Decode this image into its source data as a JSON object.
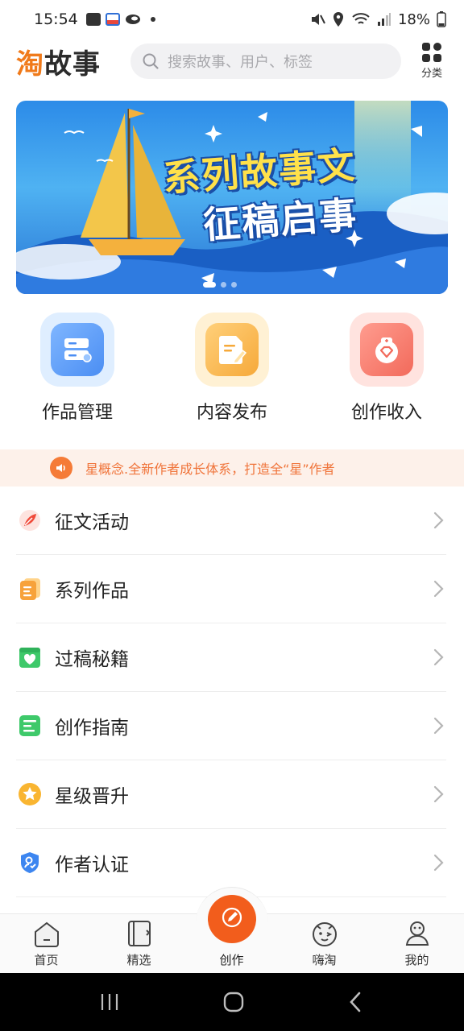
{
  "status_bar": {
    "time": "15:54",
    "battery": "18%",
    "icons": [
      "gallery-icon",
      "calendar-icon",
      "app-icon",
      "dot-icon",
      "mute-icon",
      "location-icon",
      "wifi-icon",
      "signal-icon",
      "battery-icon"
    ]
  },
  "header": {
    "logo_text_accent": "淘",
    "logo_text_rest": "故事",
    "search_placeholder": "搜索故事、用户、标签",
    "category_label": "分类"
  },
  "banner": {
    "line1": "系列故事文",
    "line2": "征稿启事",
    "slide_count": 3,
    "active_slide": 1
  },
  "quick_actions": [
    {
      "label": "作品管理",
      "icon": "works-manage-icon",
      "color": "#4b8ef3"
    },
    {
      "label": "内容发布",
      "icon": "publish-icon",
      "color": "#f6a93a"
    },
    {
      "label": "创作收入",
      "icon": "income-icon",
      "color": "#f26a5b"
    }
  ],
  "notice": {
    "text": "星概念.全新作者成长体系，打造全“星”作者",
    "color": "#f0743a"
  },
  "menu": [
    {
      "label": "征文活动",
      "icon": "contest-icon",
      "color": "#f04a3a"
    },
    {
      "label": "系列作品",
      "icon": "series-icon",
      "color": "#f7a23b"
    },
    {
      "label": "过稿秘籍",
      "icon": "tips-icon",
      "color": "#3ec96a"
    },
    {
      "label": "创作指南",
      "icon": "guide-icon",
      "color": "#3ec96a"
    },
    {
      "label": "星级晋升",
      "icon": "star-icon",
      "color": "#f9b531"
    },
    {
      "label": "作者认证",
      "icon": "verify-icon",
      "color": "#3d86f0"
    }
  ],
  "bottom_nav": [
    {
      "label": "首页",
      "icon": "home-icon"
    },
    {
      "label": "精选",
      "icon": "featured-icon"
    },
    {
      "label": "创作",
      "icon": "create-icon",
      "active": true,
      "color": "#f25d1c"
    },
    {
      "label": "嗨淘",
      "icon": "hitao-icon"
    },
    {
      "label": "我的",
      "icon": "profile-icon"
    }
  ]
}
